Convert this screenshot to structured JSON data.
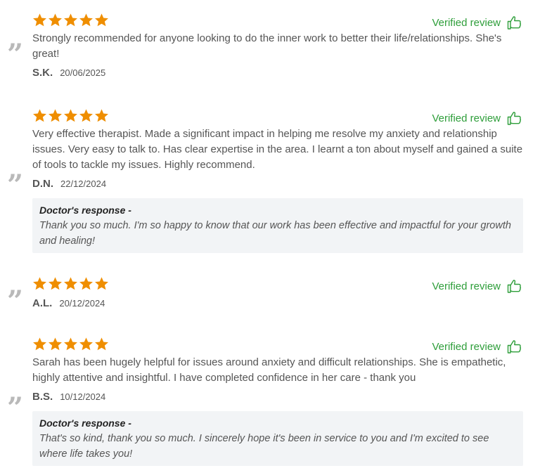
{
  "verified_label": "Verified review",
  "colors": {
    "star": "#ef8e00",
    "verified": "#2e9e3a",
    "response_bg": "#f2f4f6",
    "quote": "#b9b9b9"
  },
  "reviews": [
    {
      "rating": 5,
      "text": "Strongly recommended for anyone looking to do the inner work to better their life/relationships. She's great!",
      "initials": "S.K.",
      "date": "20/06/2025"
    },
    {
      "rating": 5,
      "text": "Very effective therapist. Made a significant impact in helping me resolve my anxiety and relationship issues. Very easy to talk to. Has clear expertise in the area. I learnt a ton about myself and gained a suite of tools to tackle my issues. Highly recommend.",
      "initials": "D.N.",
      "date": "22/12/2024",
      "response": {
        "title": "Doctor's response -",
        "text": "Thank you so much. I'm so happy to know that our work has been effective and impactful for your growth and healing!"
      }
    },
    {
      "rating": 5,
      "text": "",
      "initials": "A.L.",
      "date": "20/12/2024"
    },
    {
      "rating": 5,
      "text": "Sarah has been hugely helpful for issues around anxiety and difficult relationships. She is empathetic, highly attentive and insightful. I have completed confidence in her care - thank you",
      "initials": "B.S.",
      "date": "10/12/2024",
      "response": {
        "title": "Doctor's response -",
        "text": "That's so kind, thank you so much. I sincerely hope it's been in service to you and I'm excited to see where life takes you!"
      }
    }
  ]
}
